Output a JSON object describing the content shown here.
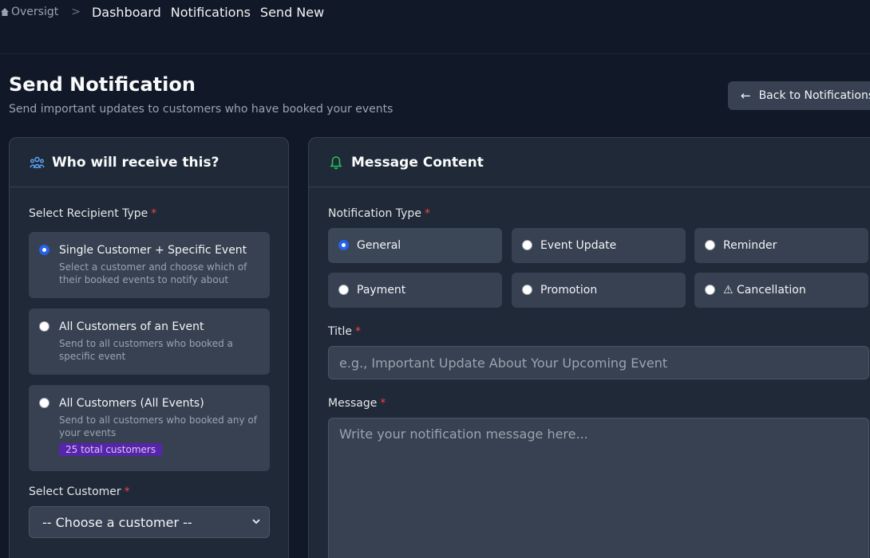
{
  "breadcrumb": {
    "brand": "Oversigt",
    "separator": ">",
    "links": [
      "Dashboard",
      "Notifications",
      "Send New"
    ]
  },
  "header": {
    "title": "Send Notification",
    "subtitle": "Send important updates to customers who have booked your events",
    "back_button": "Back to Notifications"
  },
  "recipients": {
    "panel_title": "Who will receive this?",
    "type_label": "Select Recipient Type",
    "required_mark": "*",
    "options": [
      {
        "title": " Single Customer + Specific Event",
        "desc": "Select a customer and choose which of their booked events to notify about",
        "checked": true
      },
      {
        "title": " All Customers of an Event",
        "desc": "Send to all customers who booked a specific event",
        "checked": false
      },
      {
        "title": " All Customers (All Events)",
        "desc": "Send to all customers who booked any of your events",
        "badge": "25 total customers",
        "checked": false
      }
    ],
    "customer_label": "Select Customer",
    "customer_select": "-- Choose a customer --"
  },
  "message": {
    "panel_title": "Message Content",
    "type_label": "Notification Type",
    "types": [
      {
        "label": " General",
        "selected": true
      },
      {
        "label": " Event Update",
        "selected": false
      },
      {
        "label": " Reminder",
        "selected": false
      },
      {
        "label": " Payment",
        "selected": false
      },
      {
        "label": " Promotion",
        "selected": false
      },
      {
        "label": "⚠ Cancellation",
        "selected": false
      }
    ],
    "title_label": "Title",
    "title_placeholder": "e.g., Important Update About Your Upcoming Event",
    "message_label": "Message",
    "message_placeholder": "Write your notification message here..."
  },
  "colors": {
    "background": "#111827",
    "panel": "#1f2937",
    "control": "#374151",
    "accent": "#2563eb",
    "required": "#ef4444",
    "bell_icon": "#22c55e",
    "people_icon": "#60a5fa",
    "badge": "#5b21b6"
  },
  "icons": {
    "brand": "home-icon",
    "back": "arrow-left-icon",
    "recipients": "users-icon",
    "message": "bell-icon",
    "select": "chevron-down-icon"
  }
}
